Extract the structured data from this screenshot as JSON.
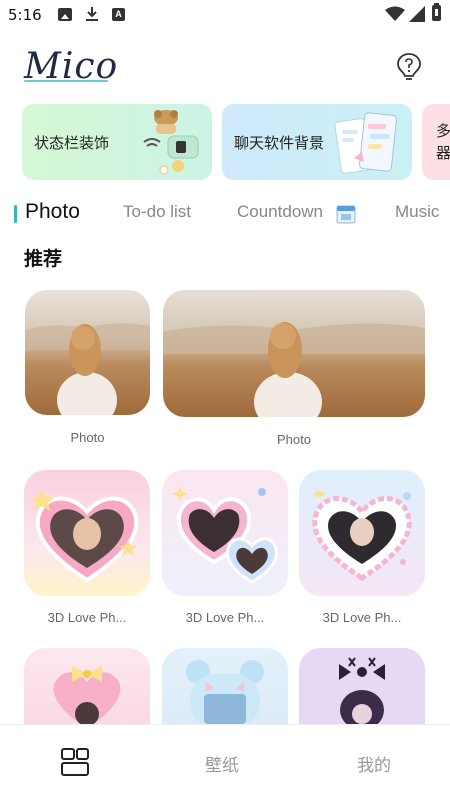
{
  "status_bar": {
    "time": "5:16",
    "a_icon_letter": "A"
  },
  "header": {
    "logo": "Mico"
  },
  "banners": [
    {
      "label": "状态栏装饰"
    },
    {
      "label": "聊天软件背景"
    },
    {
      "label": "多器"
    }
  ],
  "tabs": [
    {
      "label": "Photo",
      "active": true
    },
    {
      "label": "To-do list",
      "active": false
    },
    {
      "label": "Countdown",
      "active": false
    },
    {
      "label": "Music",
      "active": false
    }
  ],
  "section": {
    "title": "推荐"
  },
  "cards": {
    "photo_1": "Photo",
    "photo_2": "Photo",
    "love_1": "3D Love Ph...",
    "love_2": "3D Love Ph...",
    "love_3": "3D Love Ph..."
  },
  "nav": {
    "wallpaper": "壁纸",
    "mine": "我的"
  },
  "colors": {
    "accent": "#35b7c2",
    "text": "#222222",
    "muted": "#888888"
  }
}
